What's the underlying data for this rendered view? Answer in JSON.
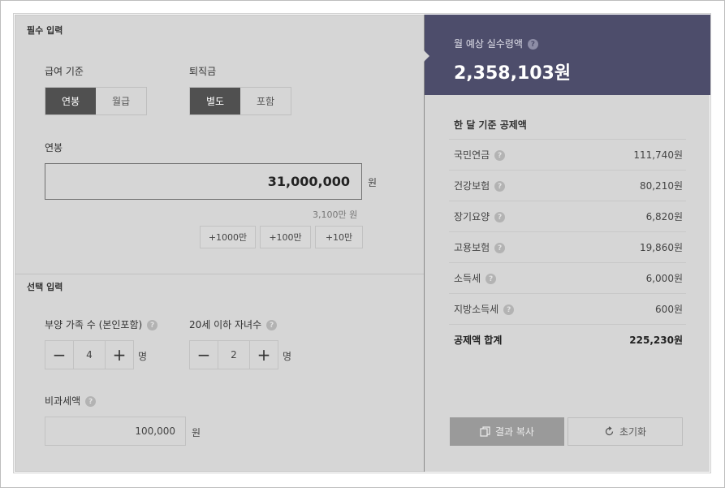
{
  "required": {
    "section_title": "필수 입력",
    "pay_basis": {
      "label": "급여 기준",
      "options": [
        "연봉",
        "월급"
      ],
      "selected": "연봉"
    },
    "severance": {
      "label": "퇴직금",
      "options": [
        "별도",
        "포함"
      ],
      "selected": "별도"
    },
    "salary": {
      "label": "연봉",
      "value": "31,000,000",
      "unit": "원",
      "hint": "3,100만 원"
    },
    "quick_add": [
      "+1000만",
      "+100만",
      "+10만"
    ]
  },
  "optional": {
    "section_title": "선택 입력",
    "dependents": {
      "label": "부양 가족 수 (본인포함)",
      "value": "4",
      "unit": "명"
    },
    "children": {
      "label": "20세 이하 자녀수",
      "value": "2",
      "unit": "명"
    },
    "nontaxable": {
      "label": "비과세액",
      "value": "100,000",
      "unit": "원"
    }
  },
  "result": {
    "label": "월 예상 실수령액",
    "value": "2,358,103원",
    "deductions_title": "한 달 기준 공제액",
    "deductions": [
      {
        "name": "국민연금",
        "amount": "111,740원"
      },
      {
        "name": "건강보험",
        "amount": "80,210원"
      },
      {
        "name": "장기요양",
        "amount": "6,820원"
      },
      {
        "name": "고용보험",
        "amount": "19,860원"
      },
      {
        "name": "소득세",
        "amount": "6,000원"
      },
      {
        "name": "지방소득세",
        "amount": "600원"
      }
    ],
    "total": {
      "name": "공제액 합계",
      "amount": "225,230원"
    },
    "copy_label": "결과 복사",
    "reset_label": "초기화"
  },
  "help_icon": "?",
  "minus": "−",
  "plus": "+",
  "colors": {
    "result_bg": "#4d4d6b",
    "active_segment": "#505050",
    "panel_bg": "#d6d6d6"
  }
}
